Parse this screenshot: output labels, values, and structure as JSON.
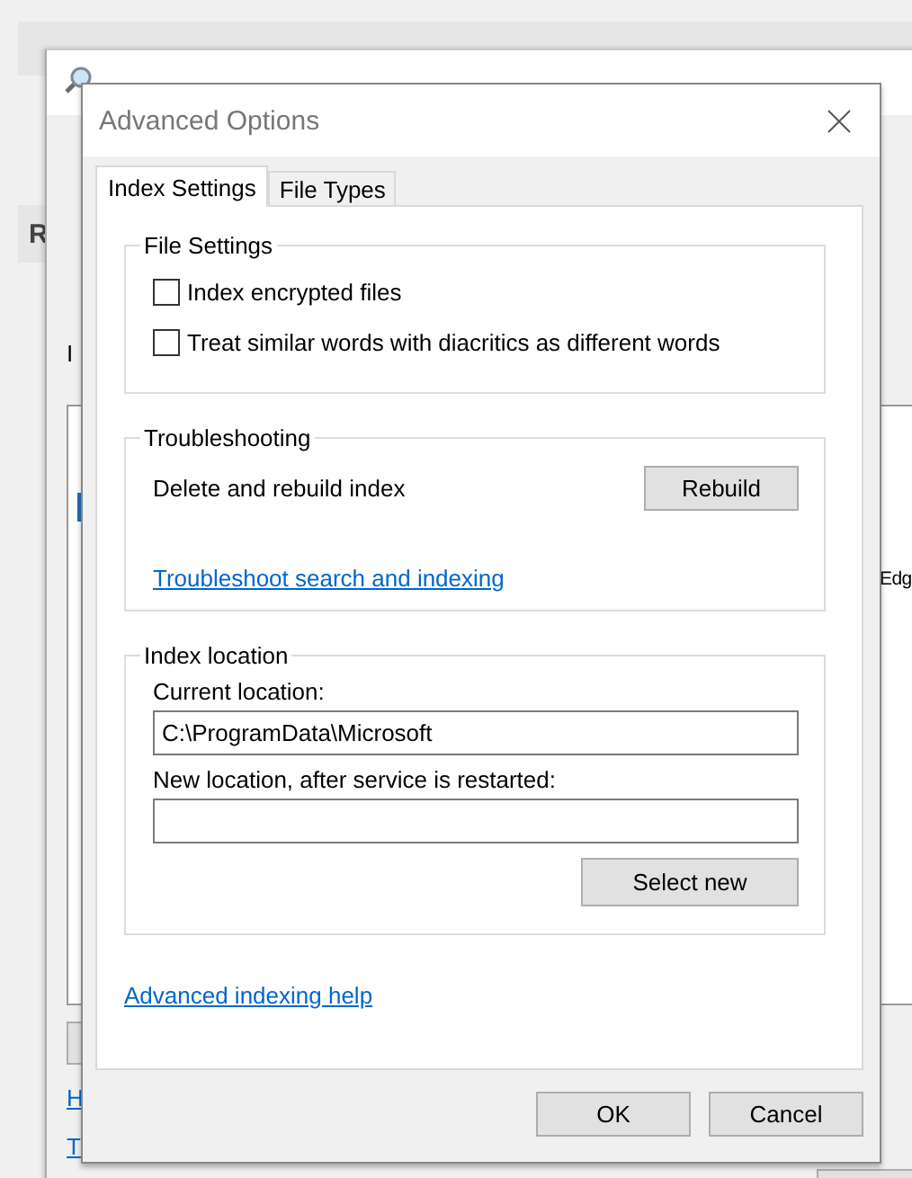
{
  "background": {
    "section_letter": "R"
  },
  "indexing_window": {
    "label": "I",
    "list_item": "Edg",
    "links": [
      "H",
      "T"
    ]
  },
  "dialog": {
    "title": "Advanced Options",
    "tabs": [
      {
        "label": "Index Settings",
        "selected": true
      },
      {
        "label": "File Types",
        "selected": false
      }
    ],
    "file_settings": {
      "title": "File Settings",
      "options": [
        {
          "label": "Index encrypted files",
          "checked": false
        },
        {
          "label": "Treat similar words with diacritics as different words",
          "checked": false
        }
      ]
    },
    "troubleshooting": {
      "title": "Troubleshooting",
      "rebuild_label": "Delete and rebuild index",
      "rebuild_button": "Rebuild",
      "link": "Troubleshoot search and indexing"
    },
    "index_location": {
      "title": "Index location",
      "current_label": "Current location:",
      "current_value": "C:\\ProgramData\\Microsoft",
      "new_label": "New location, after service is restarted:",
      "select_button": "Select new"
    },
    "help_link": "Advanced indexing help",
    "buttons": [
      "OK",
      "Cancel"
    ]
  }
}
